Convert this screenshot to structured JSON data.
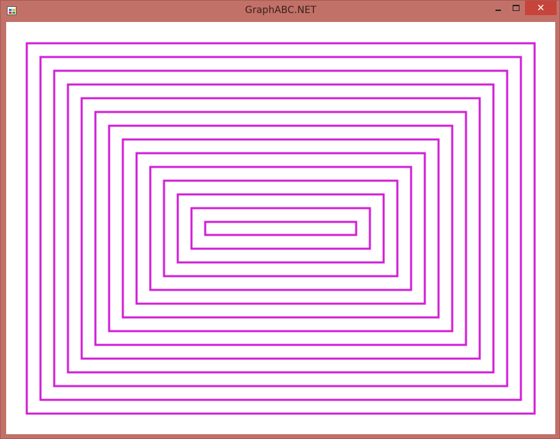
{
  "window": {
    "title": "GraphABC.NET",
    "controls": {
      "minimize_icon": "minimize-icon",
      "maximize_icon": "maximize-icon",
      "close_glyph": "✕"
    }
  },
  "canvas": {
    "background": "#ffffff",
    "stroke_color": "#d11fd6",
    "shape": "concentric-rectangles",
    "rectangle_count": 14
  }
}
